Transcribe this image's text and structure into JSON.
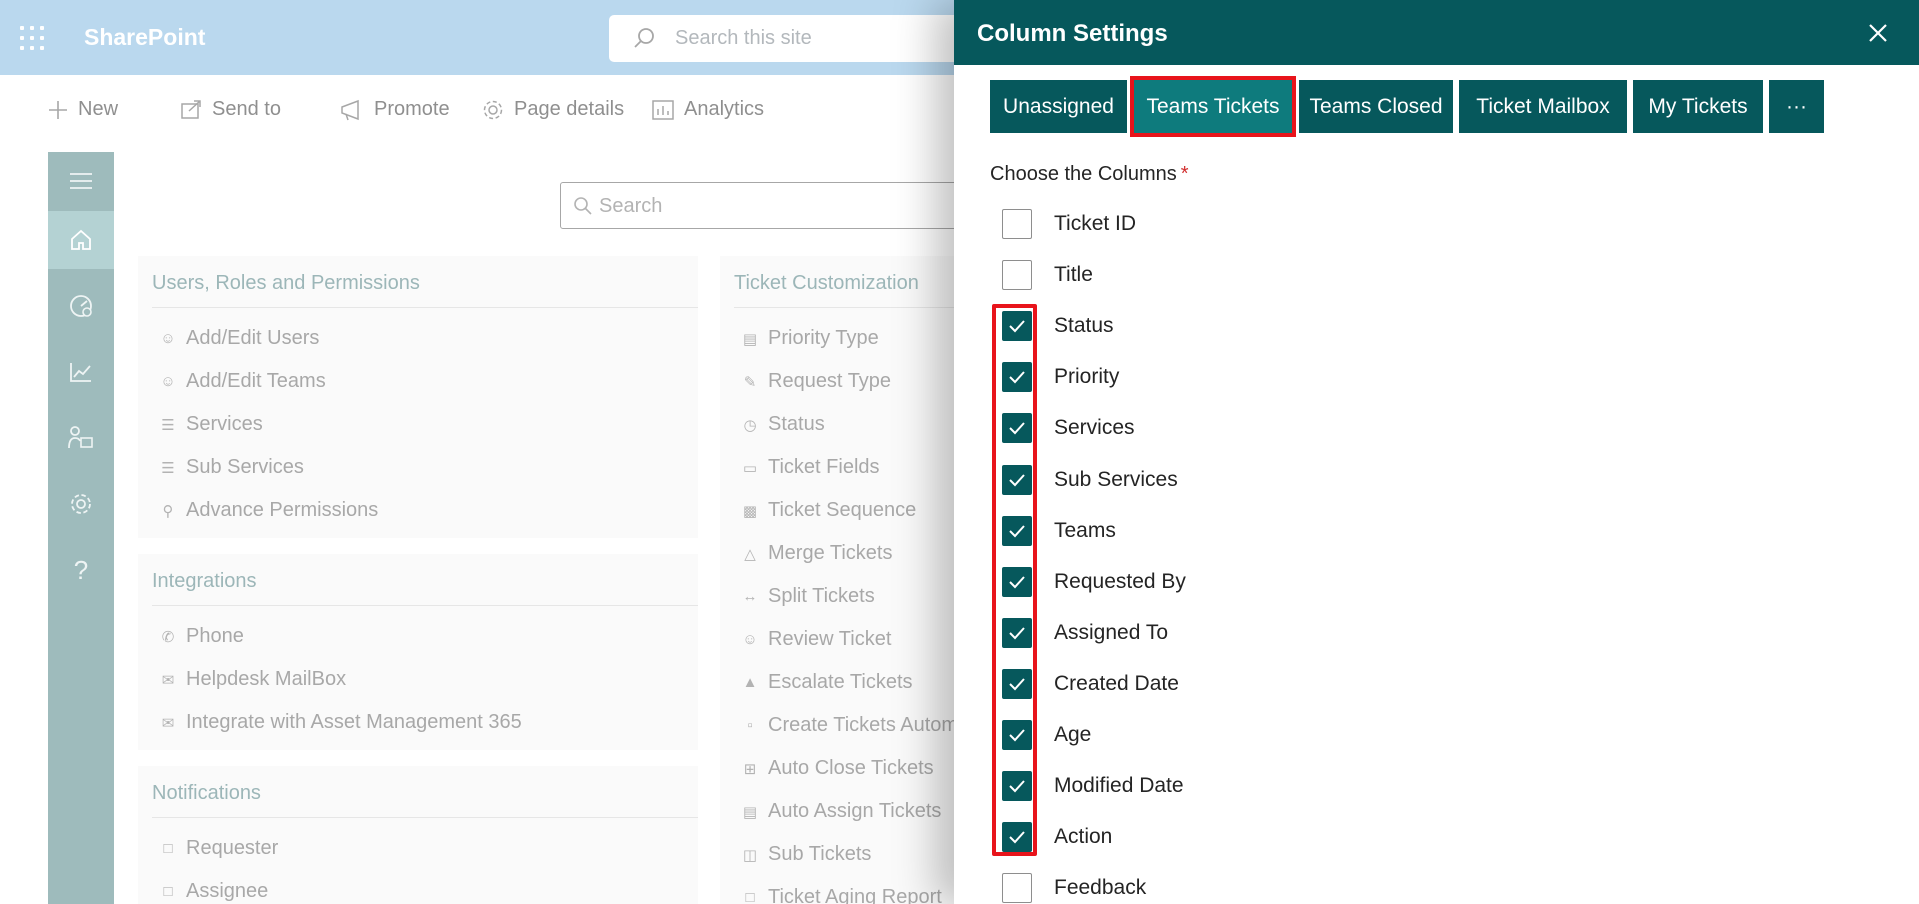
{
  "suitebar": {
    "brand": "SharePoint",
    "search_placeholder": "Search this site"
  },
  "commandbar": {
    "new": "New",
    "send_to": "Send to",
    "promote": "Promote",
    "page_details": "Page details",
    "analytics": "Analytics"
  },
  "page": {
    "search_placeholder": "Search",
    "cards": {
      "users": {
        "title": "Users, Roles and Permissions",
        "items": [
          "Add/Edit Users",
          "Add/Edit Teams",
          "Services",
          "Sub Services",
          "Advance Permissions"
        ]
      },
      "integrations": {
        "title": "Integrations",
        "items": [
          "Phone",
          "Helpdesk MailBox",
          "Integrate with Asset Management 365"
        ]
      },
      "notifications": {
        "title": "Notifications",
        "items": [
          "Requester",
          "Assignee"
        ]
      },
      "ticket": {
        "title": "Ticket Customization",
        "items": [
          "Priority Type",
          "Request Type",
          "Status",
          "Ticket Fields",
          "Ticket Sequence",
          "Merge Tickets",
          "Split Tickets",
          "Review Ticket",
          "Escalate Tickets",
          "Create Tickets Autom",
          "Auto Close Tickets",
          "Auto Assign Tickets",
          "Sub Tickets",
          "Ticket Aging Report"
        ]
      }
    }
  },
  "panel": {
    "title": "Column Settings",
    "tabs": [
      "Unassigned",
      "Teams Tickets",
      "Teams Closed",
      "Ticket Mailbox",
      "My Tickets",
      "···"
    ],
    "selected_tab": "Teams Tickets",
    "choose_label": "Choose the Columns",
    "required_mark": "*",
    "columns": [
      {
        "label": "Ticket ID",
        "checked": false
      },
      {
        "label": "Title",
        "checked": false
      },
      {
        "label": "Status",
        "checked": true
      },
      {
        "label": "Priority",
        "checked": true
      },
      {
        "label": "Services",
        "checked": true
      },
      {
        "label": "Sub Services",
        "checked": true
      },
      {
        "label": "Teams",
        "checked": true
      },
      {
        "label": "Requested By",
        "checked": true
      },
      {
        "label": "Assigned To",
        "checked": true
      },
      {
        "label": "Created Date",
        "checked": true
      },
      {
        "label": "Age",
        "checked": true
      },
      {
        "label": "Modified Date",
        "checked": true
      },
      {
        "label": "Action",
        "checked": true
      },
      {
        "label": "Feedback",
        "checked": false
      }
    ]
  },
  "colors": {
    "header": "#06585c",
    "selected_tab": "#0e7b7d",
    "highlight": "#e8141b",
    "suitebar": "#a3cbe9",
    "rail": "#7ea4a6"
  }
}
